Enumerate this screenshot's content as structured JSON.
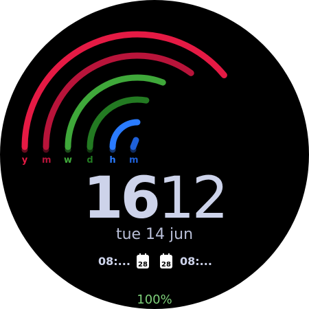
{
  "rings": [
    {
      "label": "y",
      "color": "#e51a44",
      "progress": 0.78
    },
    {
      "label": "m",
      "color": "#b8143a",
      "progress": 0.7
    },
    {
      "label": "w",
      "color": "#3fa83a",
      "progress": 0.62
    },
    {
      "label": "d",
      "color": "#237a22",
      "progress": 0.56
    },
    {
      "label": "h",
      "color": "#2a7bff",
      "progress": 0.5
    },
    {
      "label": "m",
      "color": "#1e60d8",
      "progress": 0.2
    }
  ],
  "time": {
    "hours": "16",
    "minutes": "12"
  },
  "date": "tue 14 jun",
  "events": {
    "left_text": "08:...",
    "left_calendar_day": "28",
    "right_calendar_day": "28",
    "right_text": "08:..."
  },
  "battery": "100%"
}
